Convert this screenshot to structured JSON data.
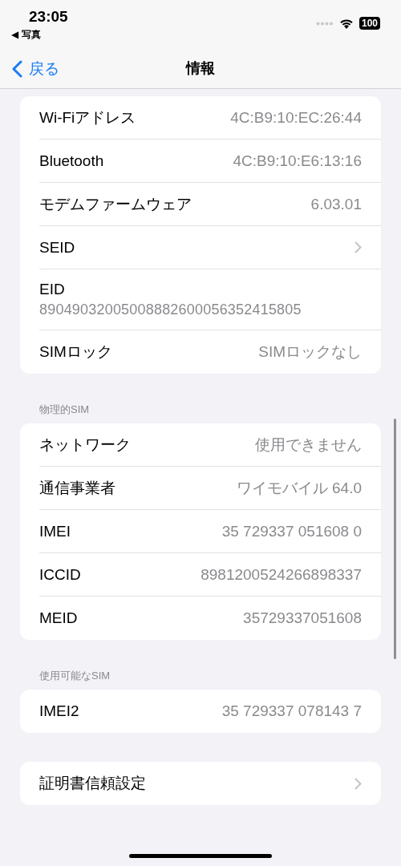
{
  "status_bar": {
    "time": "23:05",
    "back_app": "◀ 写真",
    "battery": "100"
  },
  "nav": {
    "back": "戻る",
    "title": "情報"
  },
  "sections": [
    {
      "rows": [
        {
          "kind": "value",
          "label": "Wi-Fiアドレス",
          "value": "4C:B9:10:EC:26:44"
        },
        {
          "kind": "value",
          "label": "Bluetooth",
          "value": "4C:B9:10:E6:13:16"
        },
        {
          "kind": "value",
          "label": "モデムファームウェア",
          "value": "6.03.01"
        },
        {
          "kind": "chevron",
          "label": "SEID"
        },
        {
          "kind": "stacked",
          "label": "EID",
          "value": "89049032005008882600056352415805"
        },
        {
          "kind": "value",
          "label": "SIMロック",
          "value": "SIMロックなし"
        }
      ]
    },
    {
      "header": "物理的SIM",
      "rows": [
        {
          "kind": "value",
          "label": "ネットワーク",
          "value": "使用できません"
        },
        {
          "kind": "value",
          "label": "通信事業者",
          "value": "ワイモバイル 64.0"
        },
        {
          "kind": "value",
          "label": "IMEI",
          "value": "35 729337 051608 0"
        },
        {
          "kind": "value",
          "label": "ICCID",
          "value": "8981200524266898337"
        },
        {
          "kind": "value",
          "label": "MEID",
          "value": "35729337051608"
        }
      ]
    },
    {
      "header": "使用可能なSIM",
      "rows": [
        {
          "kind": "value",
          "label": "IMEI2",
          "value": "35 729337 078143 7"
        }
      ]
    },
    {
      "rows": [
        {
          "kind": "chevron",
          "label": "証明書信頼設定"
        }
      ]
    }
  ]
}
